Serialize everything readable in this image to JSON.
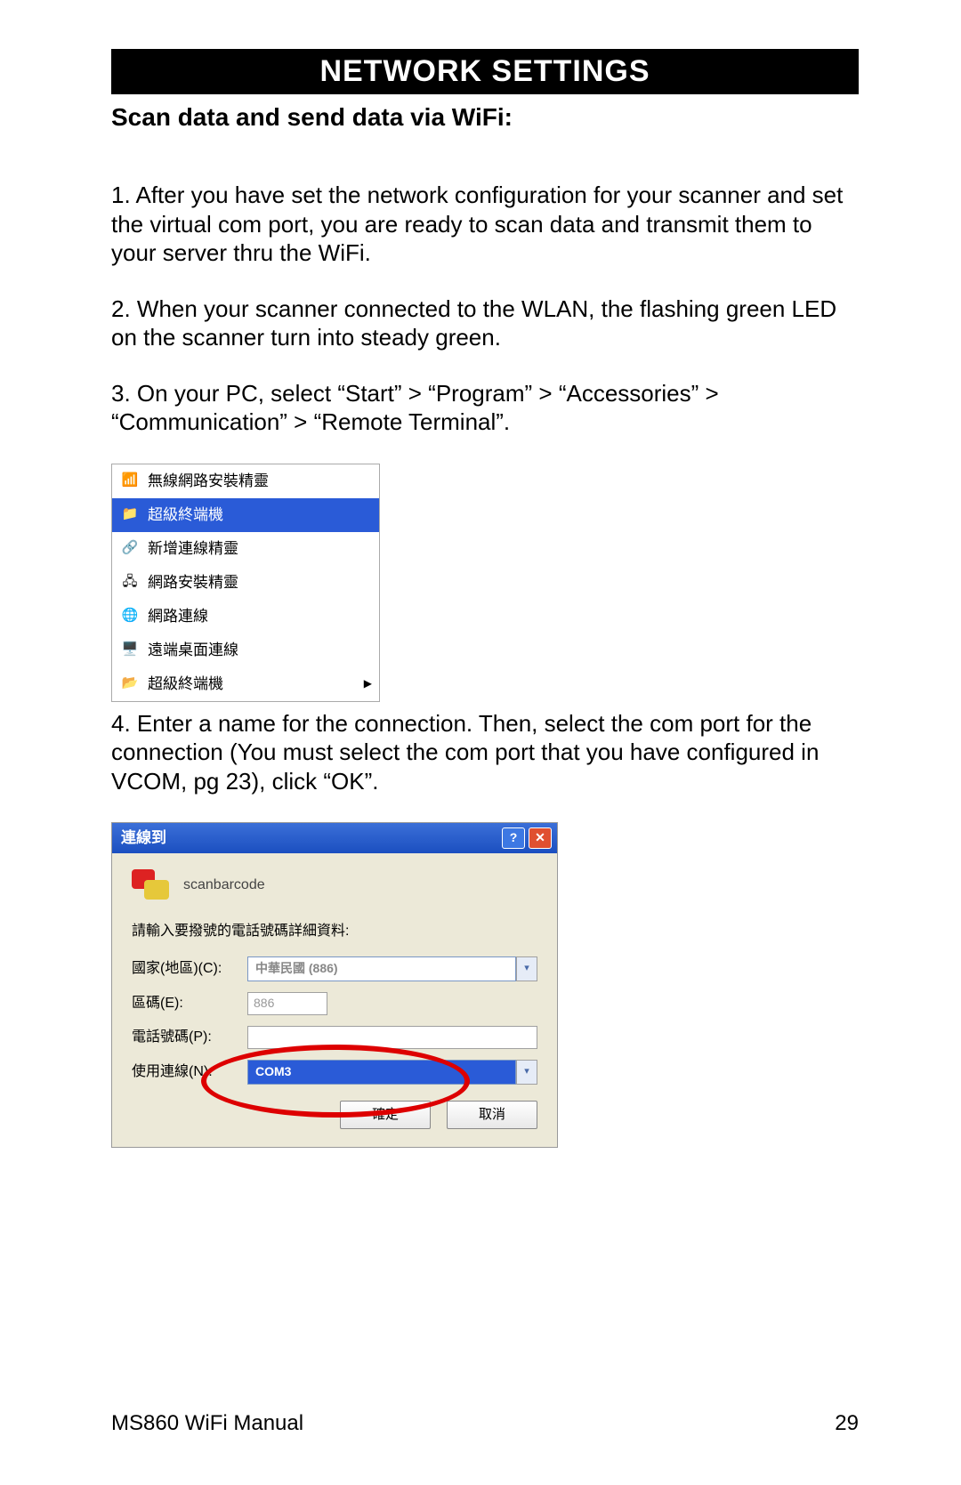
{
  "header": "NETWORK SETTINGS",
  "subtitle": "Scan data and send data via WiFi:",
  "paragraphs": {
    "p1": "1. After you have set the network configuration for your scanner and set the virtual com port, you are ready to scan data and transmit them to your server thru the WiFi.",
    "p2": "2.  When your scanner connected to the WLAN, the flashing green LED on the scanner turn into steady green.",
    "p3": "3.  On your PC, select “Start” > “Program” > “Accessories” > “Communication” > “Remote Terminal”.",
    "p4": "4. Enter a name for the connection. Then, select the com port for the connection (You must select the com port that you have configured in VCOM, pg 23), click “OK”."
  },
  "menu": {
    "items": [
      {
        "label": "無線網路安裝精靈"
      },
      {
        "label": "超級終端機"
      },
      {
        "label": "新增連線精靈"
      },
      {
        "label": "網路安裝精靈"
      },
      {
        "label": "網路連線"
      },
      {
        "label": "遠端桌面連線"
      },
      {
        "label": "超級終端機"
      }
    ]
  },
  "dialog": {
    "title": "連線到",
    "name": "scanbarcode",
    "instruction": "請輸入要撥號的電話號碼詳細資料:",
    "fields": {
      "country_label": "國家(地區)(C):",
      "country_value": "中華民國 (886)",
      "area_label": "區碼(E):",
      "area_value": "886",
      "phone_label": "電話號碼(P):",
      "phone_value": "",
      "conn_label": "使用連線(N):",
      "conn_value": "COM3"
    },
    "buttons": {
      "ok": "確定",
      "cancel": "取消"
    }
  },
  "footer": {
    "left": "MS860 WiFi Manual",
    "right": "29"
  }
}
